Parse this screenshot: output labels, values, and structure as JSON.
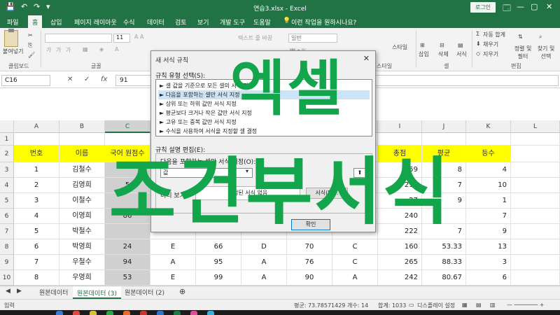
{
  "window": {
    "title": "연습3.xlsx  -  Excel",
    "login": "로그인",
    "controls": [
      "🗔",
      "—",
      "▢",
      "✕"
    ]
  },
  "menu": [
    "파일",
    "홈",
    "삽입",
    "페이지 레이아웃",
    "수식",
    "데이터",
    "검토",
    "보기",
    "개발 도구",
    "도움말",
    "이런 작업을 원하시나요?"
  ],
  "ribbon": {
    "paste": "붙여넣기",
    "clipboard": "클립보드",
    "font_group": "글꼴",
    "font_size": "11",
    "wrap_text": "텍스트 줄 바꿈",
    "number_format": "일반",
    "style_group": "스타일",
    "cells_group": "셀",
    "insert": "삽입",
    "delete": "삭제",
    "format": "서식",
    "autosum": "자동 합계",
    "fill": "채우기",
    "clear": "지우기",
    "sort_filter": "정렬 및 필터",
    "find_select": "찾기 및 선택",
    "edit_group": "편집"
  },
  "formula_bar": {
    "name_box": "C16",
    "value": "91"
  },
  "columns": [
    "A",
    "B",
    "C",
    "D",
    "E",
    "F",
    "G",
    "H",
    "I",
    "J",
    "K",
    "L"
  ],
  "rows": [
    "1",
    "2",
    "3",
    "4",
    "5",
    "6",
    "7",
    "8",
    "9",
    "10"
  ],
  "table": {
    "headers": {
      "a": "번호",
      "b": "이름",
      "c": "국어 원점수",
      "i": "총점",
      "j": "평균",
      "k": "등수"
    },
    "rows": [
      {
        "a": "1",
        "b": "김철수",
        "c": "",
        "d": "",
        "e": "",
        "f": "",
        "g": "",
        "i": "259",
        "j": "8",
        "k": "4"
      },
      {
        "a": "2",
        "b": "김영희",
        "c": "5",
        "d": "",
        "e": "",
        "f": "",
        "g": "",
        "i": "219",
        "j": "7",
        "k": "10"
      },
      {
        "a": "3",
        "b": "이철수",
        "c": "",
        "d": "",
        "e": "",
        "f": "",
        "g": "",
        "i": "27",
        "j": "9",
        "k": "1"
      },
      {
        "a": "4",
        "b": "이영희",
        "c": "86",
        "d": "",
        "e": "",
        "f": "",
        "g": "",
        "i": "240",
        "j": "",
        "k": "7"
      },
      {
        "a": "5",
        "b": "박철수",
        "c": "",
        "d": "",
        "e": "",
        "f": "",
        "g": "",
        "i": "222",
        "j": "7",
        "k": "9"
      },
      {
        "a": "6",
        "b": "박영희",
        "c": "24",
        "d": "E",
        "e": "66",
        "f": "D",
        "g": "70",
        "h": "C",
        "i": "160",
        "j": "53.33",
        "k": "13"
      },
      {
        "a": "7",
        "b": "우철수",
        "c": "94",
        "d": "A",
        "e": "95",
        "f": "A",
        "g": "76",
        "h": "C",
        "i": "265",
        "j": "88.33",
        "k": "3"
      },
      {
        "a": "8",
        "b": "우영희",
        "c": "53",
        "d": "E",
        "e": "99",
        "f": "A",
        "g": "90",
        "h": "A",
        "i": "242",
        "j": "80.67",
        "k": "6"
      }
    ]
  },
  "sheets": [
    "원본데이터",
    "원본데이터 (3)",
    "원본데이터 (2)"
  ],
  "status": {
    "mode": "입력",
    "average": "평균: 73.78571429",
    "count": "개수: 14",
    "sum": "합계: 1033",
    "display": "디스플레이 설정"
  },
  "dialog": {
    "title": "새 서식 규칙",
    "rule_type_label": "규칙 유형 선택(S):",
    "rule_types": [
      "► 셀 값을 기준으로 모든 셀의 서식 지정",
      "► 다음을 포함하는 셀만 서식 지정",
      "► 상위 또는 하위 값만 서식 지정",
      "► 평균보다 크거나 작은 값만 서식 지정",
      "► 고유 또는 중복 값만 서식 지정",
      "► 수식을 사용하여 서식을 지정할 셀 결정"
    ],
    "edit_label": "규칙 설명 편집(E):",
    "desc_label": "다음을 포함하는 셀만 서식 지정(O):",
    "select_value": "값",
    "preview_label": "미리 보기:",
    "preview_value": "설정된 서식 없음",
    "format_btn": "서식(F)...",
    "ok_btn": "확인"
  },
  "overlay": {
    "line1": "엑셀",
    "line2": "조건부서식"
  },
  "colors": {
    "excel_green": "#217346",
    "header_yellow": "#ffff00",
    "overlay_green": "#13a54b"
  }
}
